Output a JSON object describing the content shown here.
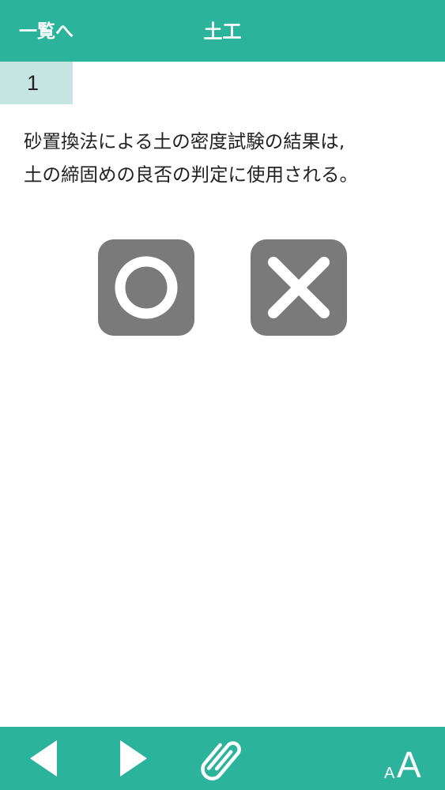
{
  "header": {
    "back_label": "一覧へ",
    "title": "土工"
  },
  "question": {
    "number": "1",
    "text": "砂置換法による土の密度試験の結果は,\n土の締固めの良否の判定に使用される。"
  },
  "answers": {
    "true_icon": "circle-icon",
    "false_icon": "cross-icon"
  },
  "footer": {
    "icons": [
      "prev-arrow-icon",
      "next-arrow-icon",
      "paperclip-icon",
      "font-size-icon"
    ],
    "font_small": "A",
    "font_large": "A"
  },
  "colors": {
    "accent": "#2bb39b",
    "number_bg": "#c6e4e1",
    "button_gray": "#7a7a7a"
  }
}
